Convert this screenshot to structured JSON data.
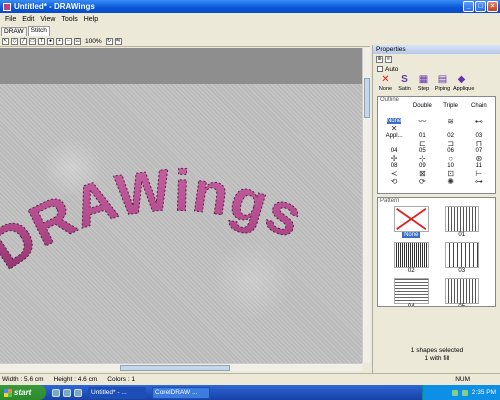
{
  "window": {
    "title": "Untitled* - DRAWings",
    "min": "_",
    "max": "□",
    "close": "×"
  },
  "menu": [
    "File",
    "Edit",
    "View",
    "Tools",
    "Help"
  ],
  "tabs": [
    "DRAW",
    "Stitch"
  ],
  "toolbar": {
    "zoom": "100%"
  },
  "canvas": {
    "artwork_text": "DRAWings",
    "thread_color": "#b44d8d"
  },
  "status": {
    "width": "Width : 5.6 cm",
    "height": "Height : 4.6 cm",
    "colors": "Colors : 1",
    "num": "NUM"
  },
  "panel": {
    "title": "Properties",
    "auto_label": "Auto",
    "types": [
      {
        "glyph": "✕",
        "label": "None"
      },
      {
        "glyph": "S",
        "label": "Satin"
      },
      {
        "glyph": "▦",
        "label": "Step"
      },
      {
        "glyph": "▤",
        "label": "Piping"
      },
      {
        "glyph": "◆",
        "label": "Applique"
      }
    ],
    "outline_section": "Outline",
    "outline_headers": [
      "",
      "Double",
      "Triple",
      "Chain"
    ],
    "outline_items": [
      {
        "label": "None",
        "glyph": "✕"
      },
      {
        "label": "",
        "glyph": "〰"
      },
      {
        "label": "",
        "glyph": "≋"
      },
      {
        "label": "",
        "glyph": "⊷"
      },
      {
        "label": "Appl...",
        "glyph": ""
      },
      {
        "label": "01",
        "glyph": "⊏"
      },
      {
        "label": "02",
        "glyph": "⊐"
      },
      {
        "label": "03",
        "glyph": "⊓"
      },
      {
        "label": "04",
        "glyph": "✢"
      },
      {
        "label": "05",
        "glyph": "⊹"
      },
      {
        "label": "06",
        "glyph": "○"
      },
      {
        "label": "07",
        "glyph": "⊛"
      },
      {
        "label": "08",
        "glyph": "≺"
      },
      {
        "label": "09",
        "glyph": "⊠"
      },
      {
        "label": "10",
        "glyph": "⊡"
      },
      {
        "label": "11",
        "glyph": "⊢"
      },
      {
        "label": "",
        "glyph": "⟲"
      },
      {
        "label": "",
        "glyph": "⟳"
      },
      {
        "label": "",
        "glyph": "✺"
      },
      {
        "label": "",
        "glyph": "⊶"
      }
    ],
    "fill_section": "Pattern",
    "fill_items": [
      {
        "label": "None",
        "style": "noneX"
      },
      {
        "label": "01",
        "style": "lines"
      },
      {
        "label": "02",
        "style": "dense"
      },
      {
        "label": "03",
        "style": "sparse"
      },
      {
        "label": "04",
        "style": "rows"
      },
      {
        "label": "05",
        "style": "lines"
      }
    ],
    "status_line1": "1 shapes selected",
    "status_line2": "1 with fill"
  },
  "taskbar": {
    "start": "start",
    "items": [
      "Untitled* - ...",
      "CorelDRAW ..."
    ],
    "clock": "2:35 PM"
  }
}
